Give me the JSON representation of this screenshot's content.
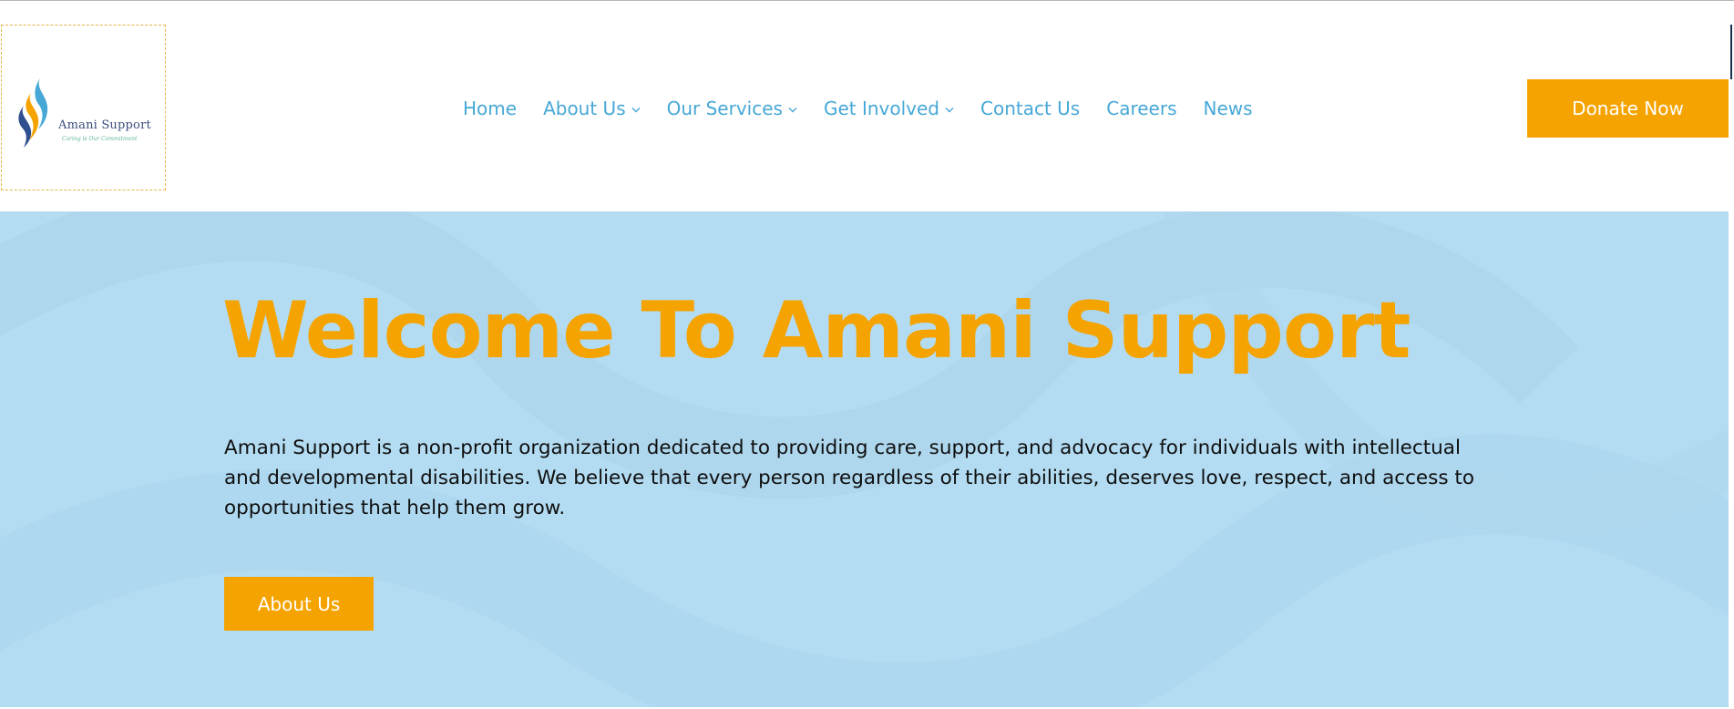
{
  "brand": {
    "name": "Amani Support",
    "tagline": "Caring is Our Commitment",
    "logo_colors": [
      "#f5a300",
      "#47a8d6",
      "#2f4f8f"
    ]
  },
  "nav": {
    "items": [
      {
        "label": "Home",
        "has_dropdown": false
      },
      {
        "label": "About Us",
        "has_dropdown": true
      },
      {
        "label": "Our Services",
        "has_dropdown": true
      },
      {
        "label": "Get Involved",
        "has_dropdown": true
      },
      {
        "label": "Contact Us",
        "has_dropdown": false
      },
      {
        "label": "Careers",
        "has_dropdown": false
      },
      {
        "label": "News",
        "has_dropdown": false
      }
    ],
    "chevron_icon": "chevron-down-icon"
  },
  "header": {
    "donate_label": "Donate Now"
  },
  "hero": {
    "title": "Welcome To Amani Support",
    "description": "Amani Support is a non-profit organization dedicated to providing care, support, and advocacy for individuals with intellectual and developmental disabilities. We believe that every person regardless of their abilities, deserves love, respect, and access to opportunities that help them grow.",
    "cta_label": "About Us"
  },
  "colors": {
    "accent": "#f5a300",
    "nav_link": "#47a8d6",
    "hero_background": "#b3dcf2",
    "text": "#0f0f0f"
  }
}
